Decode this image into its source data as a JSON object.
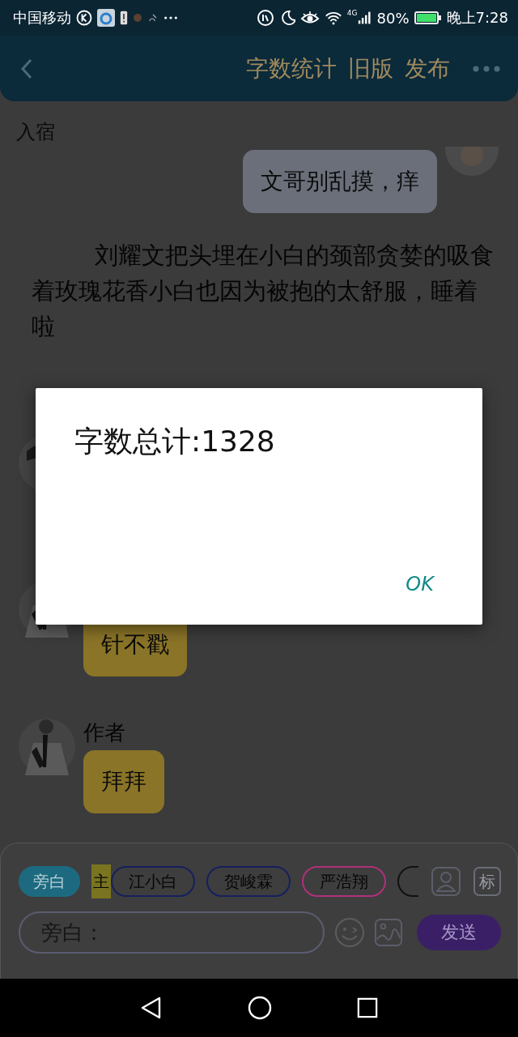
{
  "status_bar": {
    "carrier": "中国移动",
    "network": "4G",
    "battery": "80%",
    "time": "晚上7:28"
  },
  "header": {
    "actions": [
      "字数统计",
      "旧版",
      "发布"
    ]
  },
  "section_label": "入宿",
  "messages": [
    {
      "kind": "right",
      "text": "文哥别乱摸，痒"
    },
    {
      "kind": "narration",
      "text": "刘耀文把头埋在小白的颈部贪婪的吸食着玫瑰花香小白也因为被抱的太舒服，睡着啦"
    },
    {
      "kind": "covered"
    },
    {
      "kind": "left",
      "text": "针不戳"
    },
    {
      "kind": "left",
      "name": "作者",
      "text": "拜拜"
    }
  ],
  "roles": [
    {
      "label": "旁白",
      "selected": true,
      "color": "#1d6a80"
    },
    {
      "label": "江小白",
      "selected": false,
      "color": "#14205e",
      "tag": "主"
    },
    {
      "label": "贺峻霖",
      "selected": false,
      "color": "#14205e"
    },
    {
      "label": "严浩翔",
      "selected": false,
      "color": "#b0307a"
    },
    {
      "selected": false,
      "color": "#111111"
    }
  ],
  "role_button": "标",
  "input": {
    "placeholder": "旁白："
  },
  "send_button": "发送",
  "dialog": {
    "message": "字数总计:1328",
    "button": "OK"
  }
}
